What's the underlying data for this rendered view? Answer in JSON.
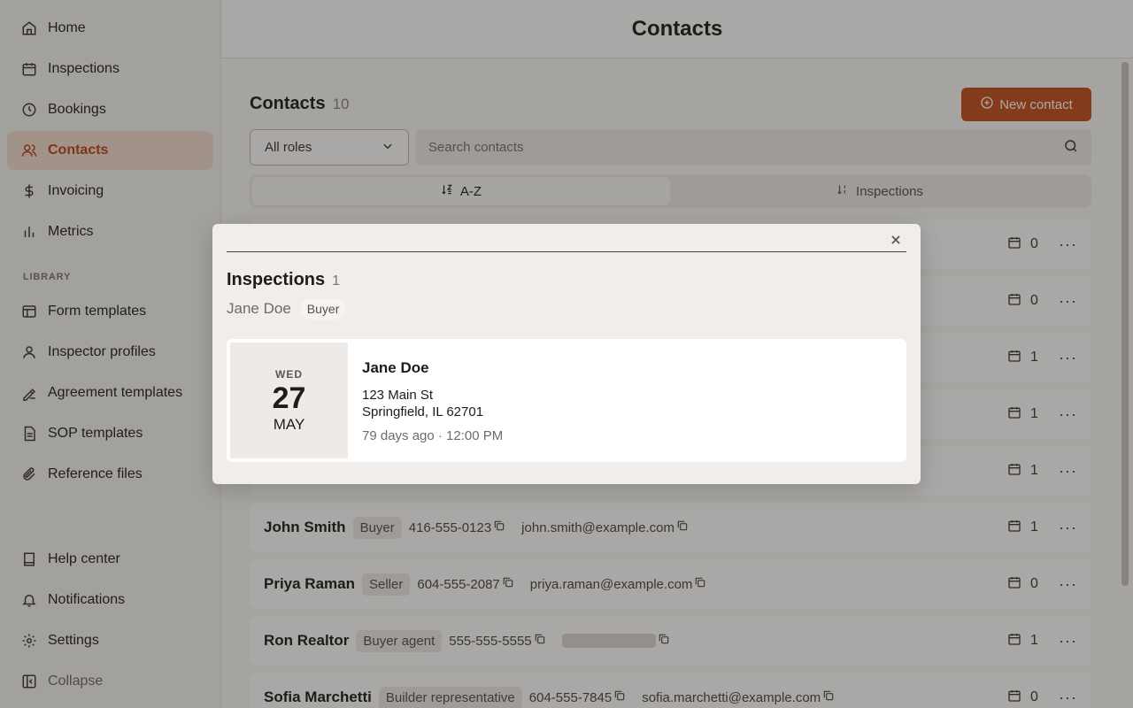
{
  "sidebar": {
    "nav": [
      {
        "label": "Home",
        "icon": "home-icon"
      },
      {
        "label": "Inspections",
        "icon": "calendar-icon"
      },
      {
        "label": "Bookings",
        "icon": "clock-icon"
      },
      {
        "label": "Contacts",
        "icon": "users-icon",
        "active": true
      },
      {
        "label": "Invoicing",
        "icon": "dollar-icon"
      },
      {
        "label": "Metrics",
        "icon": "bar-chart-icon"
      }
    ],
    "library_label": "LIBRARY",
    "library": [
      {
        "label": "Form templates",
        "icon": "layout-icon"
      },
      {
        "label": "Inspector profiles",
        "icon": "user-icon"
      },
      {
        "label": "Agreement templates",
        "icon": "signature-icon"
      },
      {
        "label": "SOP templates",
        "icon": "file-icon"
      },
      {
        "label": "Reference files",
        "icon": "paperclip-icon"
      }
    ],
    "footer": [
      {
        "label": "Help center",
        "icon": "book-icon"
      },
      {
        "label": "Notifications",
        "icon": "bell-icon"
      },
      {
        "label": "Settings",
        "icon": "gear-icon"
      },
      {
        "label": "Collapse",
        "icon": "collapse-icon"
      }
    ]
  },
  "header": {
    "title": "Contacts"
  },
  "contacts": {
    "title": "Contacts",
    "count": "10",
    "new_button": "New contact",
    "role_filter": "All roles",
    "search_placeholder": "Search contacts",
    "sort": {
      "az": "A-Z",
      "inspections": "Inspections"
    },
    "rows": [
      {
        "name": "",
        "role": "",
        "phone": "",
        "email": "",
        "count": "0"
      },
      {
        "name": "",
        "role": "",
        "phone": "",
        "email": "",
        "count": "0"
      },
      {
        "name": "",
        "role": "",
        "phone": "",
        "email": "",
        "count": "1"
      },
      {
        "name": "",
        "role": "",
        "phone": "",
        "email": "",
        "count": "1"
      },
      {
        "name": "",
        "role": "",
        "phone": "",
        "email": "",
        "count": "1"
      },
      {
        "name": "John Smith",
        "role": "Buyer",
        "phone": "416-555-0123",
        "email": "john.smith@example.com",
        "count": "1"
      },
      {
        "name": "Priya Raman",
        "role": "Seller",
        "phone": "604-555-2087",
        "email": "priya.raman@example.com",
        "count": "0"
      },
      {
        "name": "Ron Realtor",
        "role": "Buyer agent",
        "phone": "555-555-5555",
        "email": "",
        "count": "1"
      },
      {
        "name": "Sofia Marchetti",
        "role": "Builder representative",
        "phone": "604-555-7845",
        "email": "sofia.marchetti@example.com",
        "count": "0"
      }
    ]
  },
  "modal": {
    "title": "Inspections",
    "count": "1",
    "contact_name": "Jane Doe",
    "contact_role": "Buyer",
    "inspection": {
      "weekday": "WED",
      "day": "27",
      "month": "MAY",
      "client": "Jane Doe",
      "address_line1": "123 Main St",
      "address_line2": "Springfield, IL 62701",
      "time": "79 days ago · 12:00 PM"
    }
  },
  "colors": {
    "accent": "#c2501f",
    "active_bg": "#f3ddd2",
    "active_text": "#b8441a"
  }
}
